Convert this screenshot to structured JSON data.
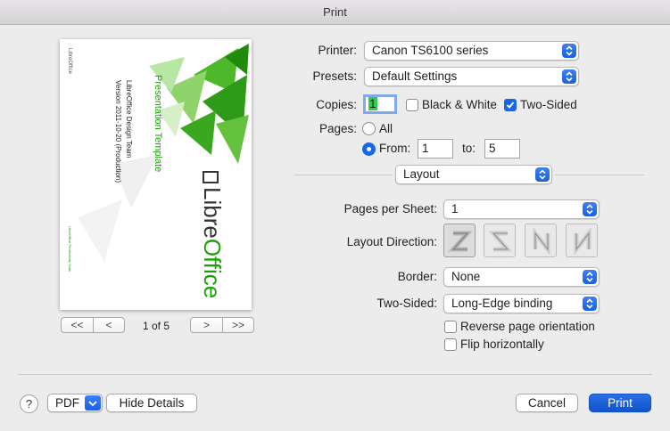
{
  "window": {
    "title": "Print"
  },
  "preview": {
    "doc_title": "Presentation Template",
    "bullets": [
      "LibreOffice Design Team",
      "Version 2011-10-20 (Production)"
    ],
    "logo_text_a": "Libre",
    "logo_text_b": "Office",
    "header_text": "LibreOffice",
    "footer_text": "LibreOffice Productivity Suite",
    "page_indicator": "1 of 5",
    "first_label": "<<",
    "prev_label": "<",
    "next_label": ">",
    "last_label": ">>"
  },
  "printer": {
    "label": "Printer:",
    "value": "Canon TS6100 series"
  },
  "presets": {
    "label": "Presets:",
    "value": "Default Settings"
  },
  "copies": {
    "label": "Copies:",
    "value": "1",
    "bw_label": "Black & White",
    "bw_checked": false,
    "two_sided_label": "Two-Sided",
    "two_sided_checked": true
  },
  "pages": {
    "label": "Pages:",
    "all_label": "All",
    "from_label": "From:",
    "from_value": "1",
    "to_label": "to:",
    "to_value": "5",
    "selected": "from"
  },
  "section": {
    "value": "Layout"
  },
  "layout": {
    "pages_per_sheet_label": "Pages per Sheet:",
    "pages_per_sheet_value": "1",
    "direction_label": "Layout Direction:",
    "border_label": "Border:",
    "border_value": "None",
    "two_sided_label": "Two-Sided:",
    "two_sided_value": "Long-Edge binding",
    "reverse_label": "Reverse page orientation",
    "reverse_checked": false,
    "flip_label": "Flip horizontally",
    "flip_checked": false
  },
  "footer": {
    "help": "?",
    "pdf_label": "PDF",
    "hide_details_label": "Hide Details",
    "cancel_label": "Cancel",
    "print_label": "Print"
  },
  "colors": {
    "accent": "#1a66e8",
    "libre_green": "#18a303"
  }
}
